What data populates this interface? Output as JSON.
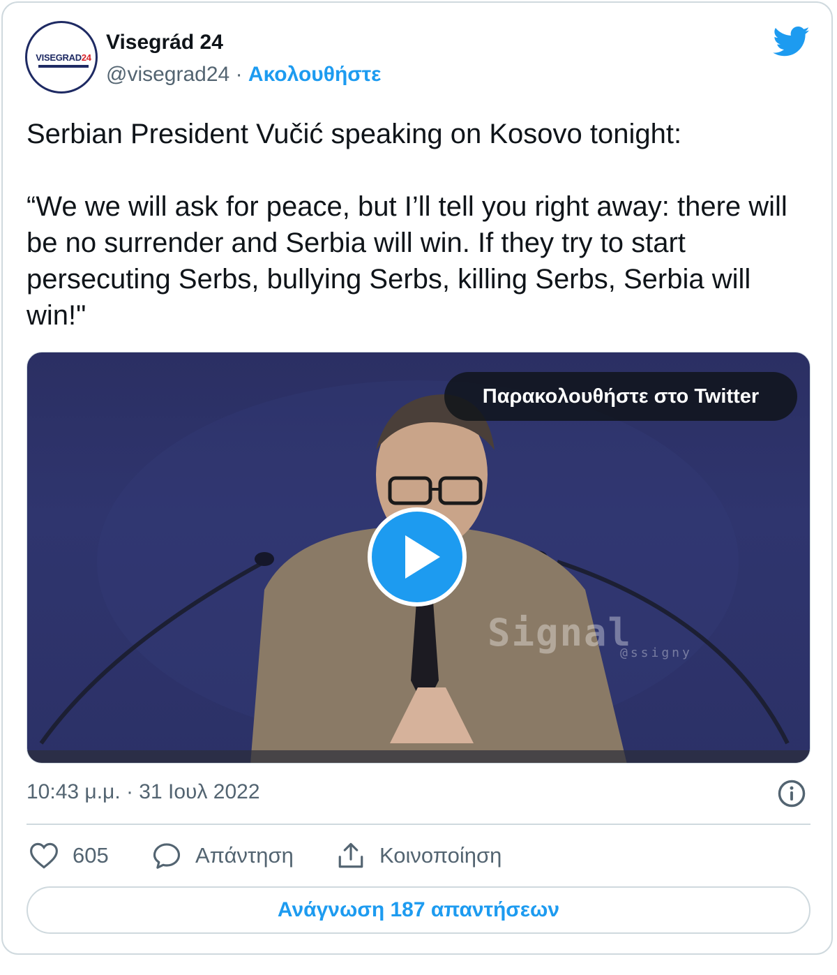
{
  "tweet": {
    "author_name": "Visegrád 24",
    "handle": "@visegrad24",
    "separator": "·",
    "follow_label": "Ακολουθήστε",
    "avatar_text_main": "VISEGRAD",
    "avatar_text_accent": "24",
    "text_paragraphs": [
      "Serbian President Vučić speaking on Kosovo tonight:",
      "“We we will ask for peace, but I’ll tell you right away: there will be no surrender and Serbia will win. If they try to start persecuting Serbs, bullying Serbs, killing Serbs, Serbia will win!\""
    ],
    "media": {
      "watch_label": "Παρακολουθήστε στο Twitter",
      "watermark": "Signal",
      "watermark_handle": "@ssigny"
    },
    "timestamp": "10:43 μ.μ. · 31 Ιουλ 2022",
    "likes_count": "605",
    "reply_label": "Απάντηση",
    "share_label": "Κοινοποίηση",
    "read_replies_label": "Ανάγνωση 187 απαντήσεων"
  },
  "colors": {
    "accent": "#1d9bf0",
    "text": "#0f1419",
    "muted": "#536471",
    "border": "#cfd9de"
  },
  "icons": [
    "twitter-bird-icon",
    "play-icon",
    "info-icon",
    "heart-icon",
    "reply-icon",
    "share-icon"
  ]
}
